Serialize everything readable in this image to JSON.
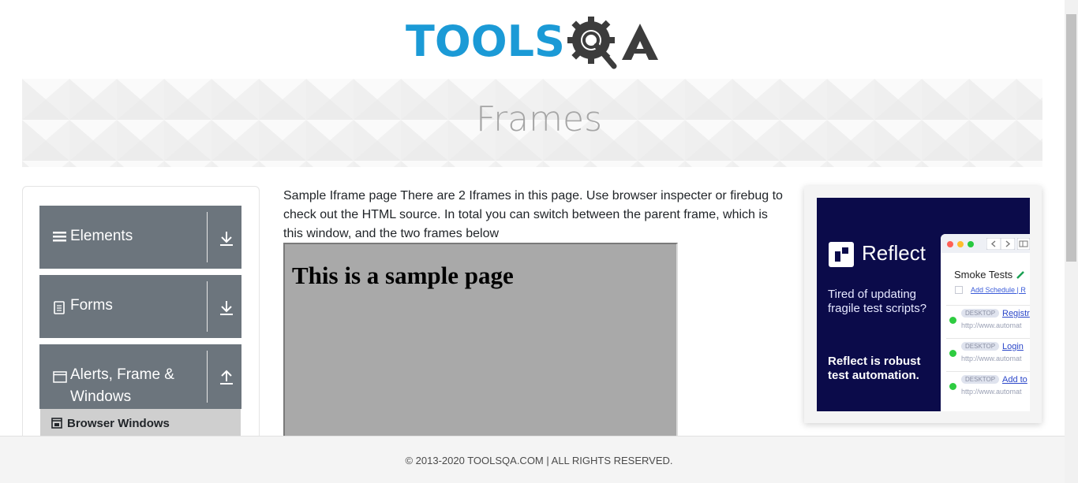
{
  "brand": {
    "logo_text_primary": "TOOLS",
    "logo_text_secondary": "QA",
    "colors": {
      "primary": "#1b9ad6",
      "secondary": "#3c3c3c"
    }
  },
  "banner": {
    "title": "Frames"
  },
  "sidebar": {
    "groups": [
      {
        "label": "Elements",
        "icon": "hamburger-icon",
        "state": "collapsed"
      },
      {
        "label": "Forms",
        "icon": "document-icon",
        "state": "collapsed"
      },
      {
        "label": "Alerts, Frame & Windows",
        "icon": "window-icon",
        "state": "expanded"
      }
    ],
    "sub_items": [
      {
        "label": "Browser Windows",
        "icon": "browser-icon"
      }
    ]
  },
  "main": {
    "intro": "Sample Iframe page There are 2 Iframes in this page. Use browser inspecter or firebug to check out the HTML source. In total you can switch between the parent frame, which is this window, and the two frames below",
    "iframe_heading": "This is a sample page"
  },
  "ad": {
    "brand": "Reflect",
    "tagline": "Tired of updating fragile test scripts?",
    "pitch": "Reflect is robust test automation.",
    "window": {
      "title": "Smoke Tests",
      "link": "Add Schedule | R",
      "rows": [
        {
          "tag": "DESKTOP",
          "name": "Registr",
          "url": "http://www.automat"
        },
        {
          "tag": "DESKTOP",
          "name": "Login",
          "url": "http://www.automat"
        },
        {
          "tag": "DESKTOP",
          "name": "Add to",
          "url": "http://www.automat"
        }
      ]
    }
  },
  "footer": {
    "text": "© 2013-2020 TOOLSQA.COM | ALL RIGHTS RESERVED."
  }
}
